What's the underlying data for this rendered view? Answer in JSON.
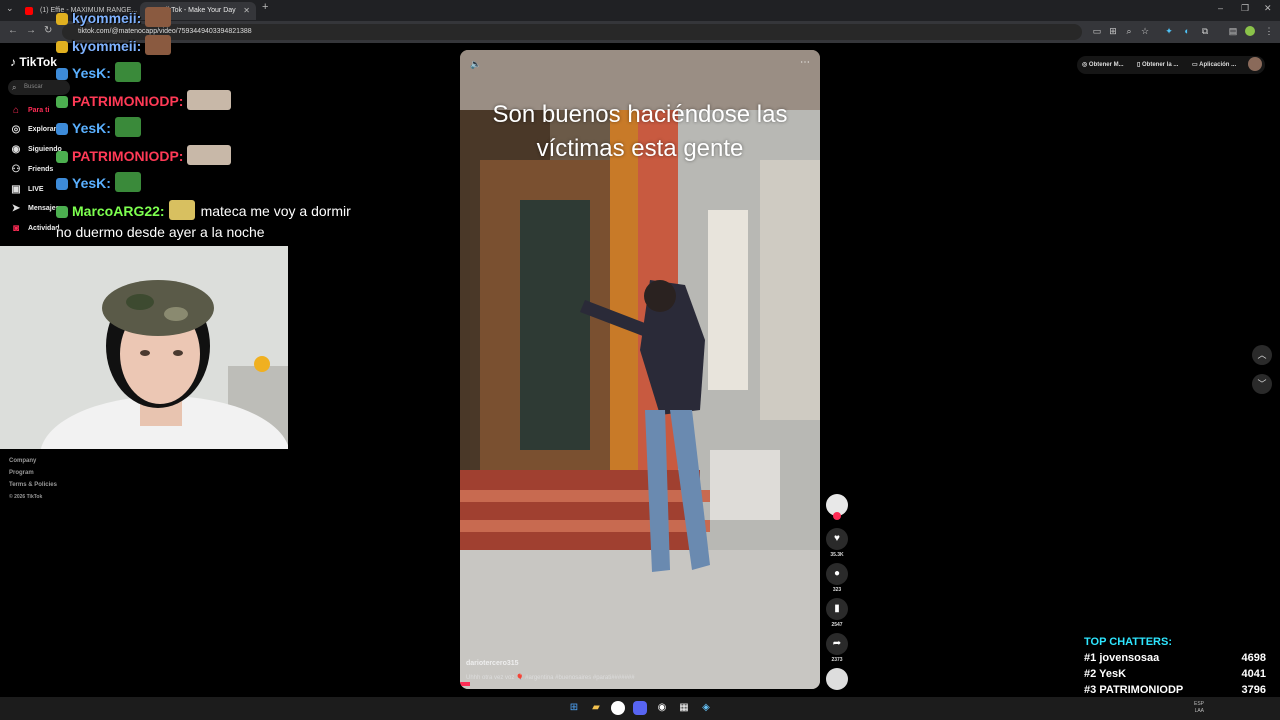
{
  "browser": {
    "tabs": [
      {
        "title": "(1) Effie - MAXIMUM RANGE...",
        "favicon": "youtube-icon",
        "active": false
      },
      {
        "title": "TikTok - Make Your Day",
        "favicon": "tiktok-icon",
        "active": true
      }
    ],
    "url": "tiktok.com/@matenocapp/video/7593449403394821388",
    "new_tab": "+",
    "window_controls": [
      "–",
      "❐",
      "✕"
    ]
  },
  "tiktok": {
    "logo": "TikTok",
    "search_placeholder": "Buscar",
    "nav": [
      {
        "label": "Para ti",
        "icon": "home-icon",
        "active": true
      },
      {
        "label": "Explorar",
        "icon": "compass-icon",
        "active": false
      },
      {
        "label": "Siguiendo",
        "icon": "following-icon",
        "active": false
      },
      {
        "label": "Friends",
        "icon": "friends-icon",
        "active": false
      },
      {
        "label": "LIVE",
        "icon": "live-icon",
        "active": false
      },
      {
        "label": "Mensajes",
        "icon": "send-icon",
        "active": false
      },
      {
        "label": "Actividad",
        "icon": "activity-icon",
        "active": false
      }
    ],
    "footer": [
      "Company",
      "Program",
      "Terms & Policies",
      "© 2026 TikTok"
    ],
    "top_pills": [
      "Obtener M...",
      "Obtener la ...",
      "Aplicación ..."
    ],
    "video": {
      "caption": "Son buenos haciéndose las víctimas esta gente",
      "author": "dariotercero315",
      "description": "Uhhh otra vez voz 🎈 #argentina #buenosaires #parati#######"
    },
    "actions": [
      {
        "name": "like",
        "icon": "heart-icon",
        "count": "35.3K"
      },
      {
        "name": "comment",
        "icon": "comment-icon",
        "count": "323"
      },
      {
        "name": "save",
        "icon": "bookmark-icon",
        "count": "2547"
      },
      {
        "name": "share",
        "icon": "share-icon",
        "count": "2373"
      }
    ]
  },
  "stream_chat": [
    {
      "user": "kyommeii:",
      "color": "#7fb2ff",
      "emote": true,
      "message": ""
    },
    {
      "user": "kyommeii:",
      "color": "#7fb2ff",
      "emote": true,
      "message": ""
    },
    {
      "user": "YesK:",
      "color": "#5ab0ff",
      "emote": true,
      "message": ""
    },
    {
      "user": "PATRIMONIODP:",
      "color": "#ff3a56",
      "emote": true,
      "message": ""
    },
    {
      "user": "YesK:",
      "color": "#5ab0ff",
      "emote": true,
      "message": ""
    },
    {
      "user": "PATRIMONIODP:",
      "color": "#ff3a56",
      "emote": true,
      "message": ""
    },
    {
      "user": "YesK:",
      "color": "#5ab0ff",
      "emote": true,
      "message": ""
    },
    {
      "user": "MarcoARG22:",
      "color": "#7dff4f",
      "emote": true,
      "message": "mateca me voy a dormir"
    },
    {
      "user": "",
      "color": "#ffffff",
      "emote": false,
      "message": "no duermo desde ayer a la noche"
    }
  ],
  "top_chatters": {
    "title": "TOP CHATTERS:",
    "rows": [
      {
        "rank": "#1",
        "name": "jovensosaa",
        "count": "4698"
      },
      {
        "rank": "#2",
        "name": "YesK",
        "count": "4041"
      },
      {
        "rank": "#3",
        "name": "PATRIMONIODP",
        "count": "3796"
      }
    ]
  },
  "taskbar": {
    "tray_lang": "ESP\nLAA"
  },
  "colors": {
    "tiktok_red": "#fe2c55",
    "chatters_title": "#2ee6ff"
  }
}
